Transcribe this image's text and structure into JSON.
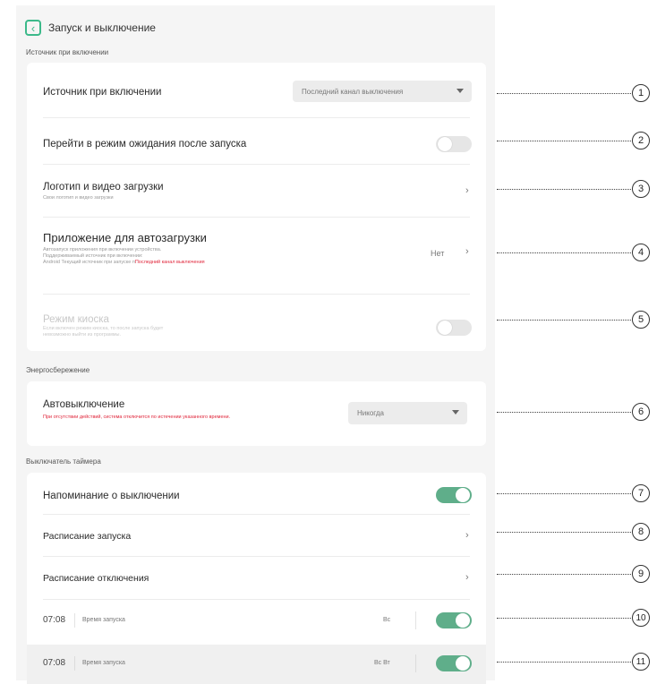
{
  "header": {
    "title": "Запуск и выключение"
  },
  "sections": {
    "power_on": "Источник при включении",
    "energy": "Энергосбережение",
    "timer": "Выключатель таймера"
  },
  "power_on": {
    "source": {
      "label": "Источник при включении",
      "value": "Последний канал выключения"
    },
    "standby": {
      "label": "Перейти в режим ожидания после запуска",
      "enabled": false
    },
    "logo": {
      "label": "Логотип и видео загрузки",
      "sub": "Свои логотип и видео загрузки"
    },
    "autostart": {
      "label": "Приложение для автозагрузки",
      "sub1": "Автозапуск приложения при включении устройства.",
      "sub2": "Поддерживаемый источник при включении:",
      "sub3": "Android Текущий источник при запуске п",
      "sub_red": "Последний канал выключения",
      "value": "Нет"
    },
    "kiosk": {
      "label": "Режим киоска",
      "sub1": "Если включен режим киоска, то после запуска будет",
      "sub2": "невозможно выйти из программы.",
      "enabled": false
    }
  },
  "energy": {
    "auto_off": {
      "label": "Автовыключение",
      "sub": "При отсутствии действий, система отключится по истечении указанного времени.",
      "value": "Никогда"
    }
  },
  "timer": {
    "reminder": {
      "label": "Напоминание о выключении",
      "enabled": true
    },
    "startup_schedule": {
      "label": "Расписание запуска"
    },
    "shutdown_schedule": {
      "label": "Расписание отключения"
    },
    "entries": [
      {
        "time": "07:08",
        "label": "Время запуска",
        "days": "Вс",
        "enabled": true
      },
      {
        "time": "07:08",
        "label": "Время запуска",
        "days": "Вс Вт",
        "enabled": true
      }
    ]
  },
  "callouts": [
    "1",
    "2",
    "3",
    "4",
    "5",
    "6",
    "7",
    "8",
    "9",
    "10",
    "11"
  ],
  "colors": {
    "accent": "#3cb98a",
    "toggle_on": "#5fae8a",
    "warning": "#e0263b"
  },
  "icons": {
    "back": "chevron-left-icon",
    "chevron": "chevron-right-icon",
    "dropdown": "triangle-down-icon"
  }
}
